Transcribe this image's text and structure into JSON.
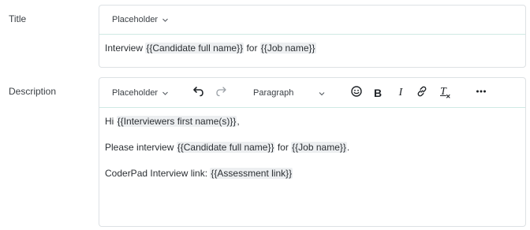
{
  "title_field": {
    "label": "Title",
    "placeholder_dropdown": "Placeholder",
    "value": {
      "before": "Interview ",
      "token1": "{{Candidate full name}}",
      "middle": " for ",
      "token2": "{{Job name}}"
    }
  },
  "description_field": {
    "label": "Description",
    "toolbar": {
      "placeholder_dropdown": "Placeholder",
      "paragraph_style": "Paragraph",
      "bold": "B",
      "italic": "I",
      "clear_format": "T"
    },
    "paragraphs": {
      "p1": {
        "before": "Hi ",
        "token": "{{Interviewers first name(s)}}",
        "after": ","
      },
      "p2": {
        "before": "Please interview ",
        "token1": "{{Candidate full name}}",
        "middle": " for ",
        "token2": "{{Job name}}",
        "after": "."
      },
      "p3": {
        "before": "CoderPad Interview link: ",
        "token": "{{Assessment link}}"
      }
    }
  },
  "icons": [
    "chevron-down-icon",
    "undo-icon",
    "redo-icon",
    "emoji-icon",
    "bold-icon",
    "italic-icon",
    "link-icon",
    "clear-format-icon",
    "more-icon"
  ],
  "colors": {
    "border": "#dde1e4",
    "toolbar_divider": "#cfe9e4",
    "token_bg": "#edeff1",
    "text": "#2b2f33"
  }
}
